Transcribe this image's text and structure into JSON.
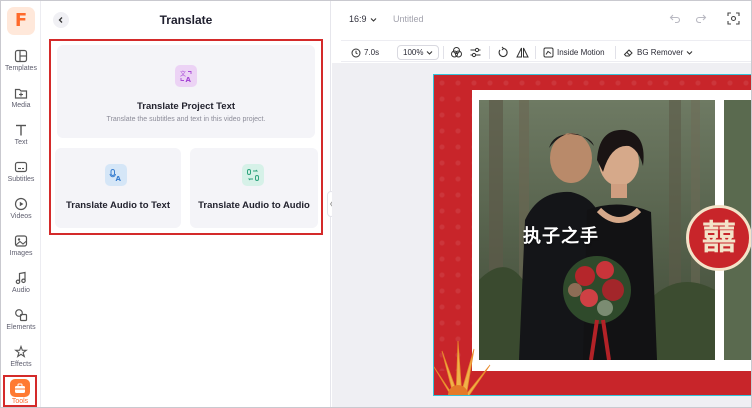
{
  "app": {
    "logo_letter": "F"
  },
  "rail": {
    "items": [
      {
        "label": "Templates",
        "icon": "templates-icon"
      },
      {
        "label": "Media",
        "icon": "media-icon"
      },
      {
        "label": "Text",
        "icon": "text-icon"
      },
      {
        "label": "Subtitles",
        "icon": "subtitles-icon"
      },
      {
        "label": "Videos",
        "icon": "videos-icon"
      },
      {
        "label": "Images",
        "icon": "images-icon"
      },
      {
        "label": "Audio",
        "icon": "audio-icon"
      },
      {
        "label": "Elements",
        "icon": "elements-icon"
      },
      {
        "label": "Effects",
        "icon": "effects-icon"
      },
      {
        "label": "Tools",
        "icon": "tools-icon",
        "active": true
      }
    ]
  },
  "panel": {
    "title": "Translate",
    "cards": [
      {
        "title": "Translate Project Text",
        "desc": "Translate the subtitles and text in this video project.",
        "icon": "translate-text-icon"
      },
      {
        "title": "Translate Audio to Text",
        "icon": "audio-to-text-icon"
      },
      {
        "title": "Translate Audio to Audio",
        "icon": "audio-to-audio-icon"
      }
    ]
  },
  "topbar": {
    "ratio": "16:9",
    "doc_title": "Untitled"
  },
  "toolbar": {
    "duration": "7.0s",
    "zoom": "100%",
    "inside_motion": "Inside Motion",
    "bg_remover": "BG Remover"
  },
  "canvas": {
    "caption": "执子之手",
    "seal_char": "囍"
  },
  "colors": {
    "accent": "#ff6a2b",
    "highlight": "#d42a2a",
    "slide_bg": "#c8252a"
  }
}
